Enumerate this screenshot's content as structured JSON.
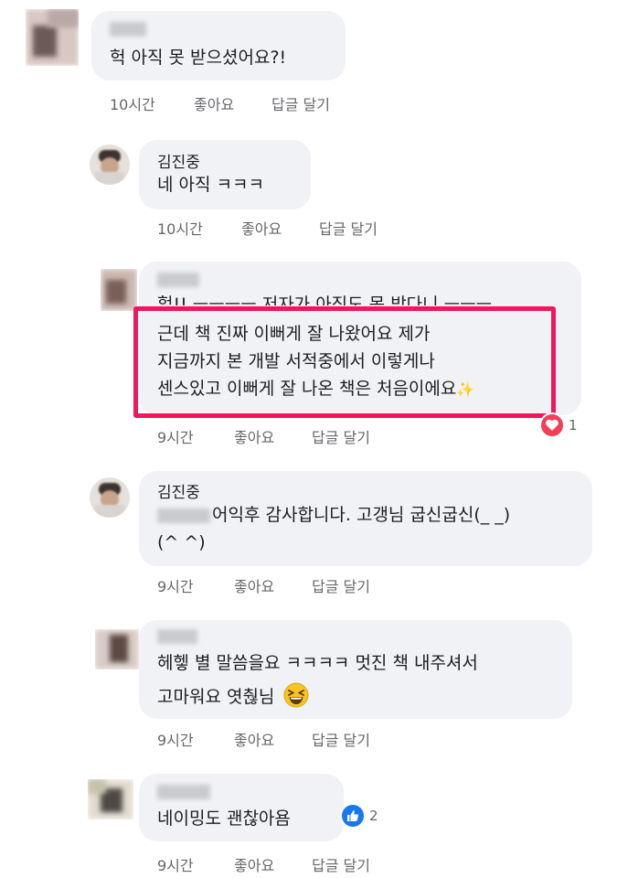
{
  "comments": [
    {
      "author": "",
      "text": [
        "헉 아직 못 받으셨어요?!"
      ],
      "time": "10시간",
      "like": "좋아요",
      "reply": "답글 달기"
    },
    {
      "author": "김진중",
      "text": [
        "네 아직 ㅋㅋㅋ"
      ],
      "time": "10시간",
      "like": "좋아요",
      "reply": "답글 달기"
    },
    {
      "author": "",
      "text": [
        "헐!! ㅡㅡㅡㅡ 저자가 아직도 못 받다니 ㅡㅡㅡ",
        "근데 책 진짜 이뻐게 잘 나왔어요 제가",
        "지금까지 본 개발 서적중에서 이렇게나",
        "센스있고 이뻐게 잘 나온 책은 처음이에요"
      ],
      "sparkle": "✨",
      "time": "9시간",
      "like": "좋아요",
      "reply": "답글 달기",
      "reaction_icon": "heart-icon",
      "reaction_count": "1"
    },
    {
      "author": "김진중",
      "text": [
        "어익후 감사합니다. 고갱님 굽신굽신(_ _)",
        "(^ ^)"
      ],
      "time": "9시간",
      "like": "좋아요",
      "reply": "답글 달기"
    },
    {
      "author": "",
      "text": [
        "헤헿 별 말씀을요 ㅋㅋㅋㅋ 멋진 책 내주셔서",
        "고마워요 엿춶님"
      ],
      "emoji": "😆",
      "time": "9시간",
      "like": "좋아요",
      "reply": "답글 달기"
    },
    {
      "author": "",
      "text": [
        "네이밍도 괜찮아욤"
      ],
      "time": "9시간",
      "like": "좋아요",
      "reply": "답글 달기",
      "reaction_icon": "thumbs-up-icon",
      "reaction_count": "2"
    }
  ],
  "colors": {
    "bubble": "#f0f2f5",
    "highlight": "#f0175d",
    "heart": "#f33e58",
    "like": "#1877f2",
    "meta": "#65676b"
  }
}
